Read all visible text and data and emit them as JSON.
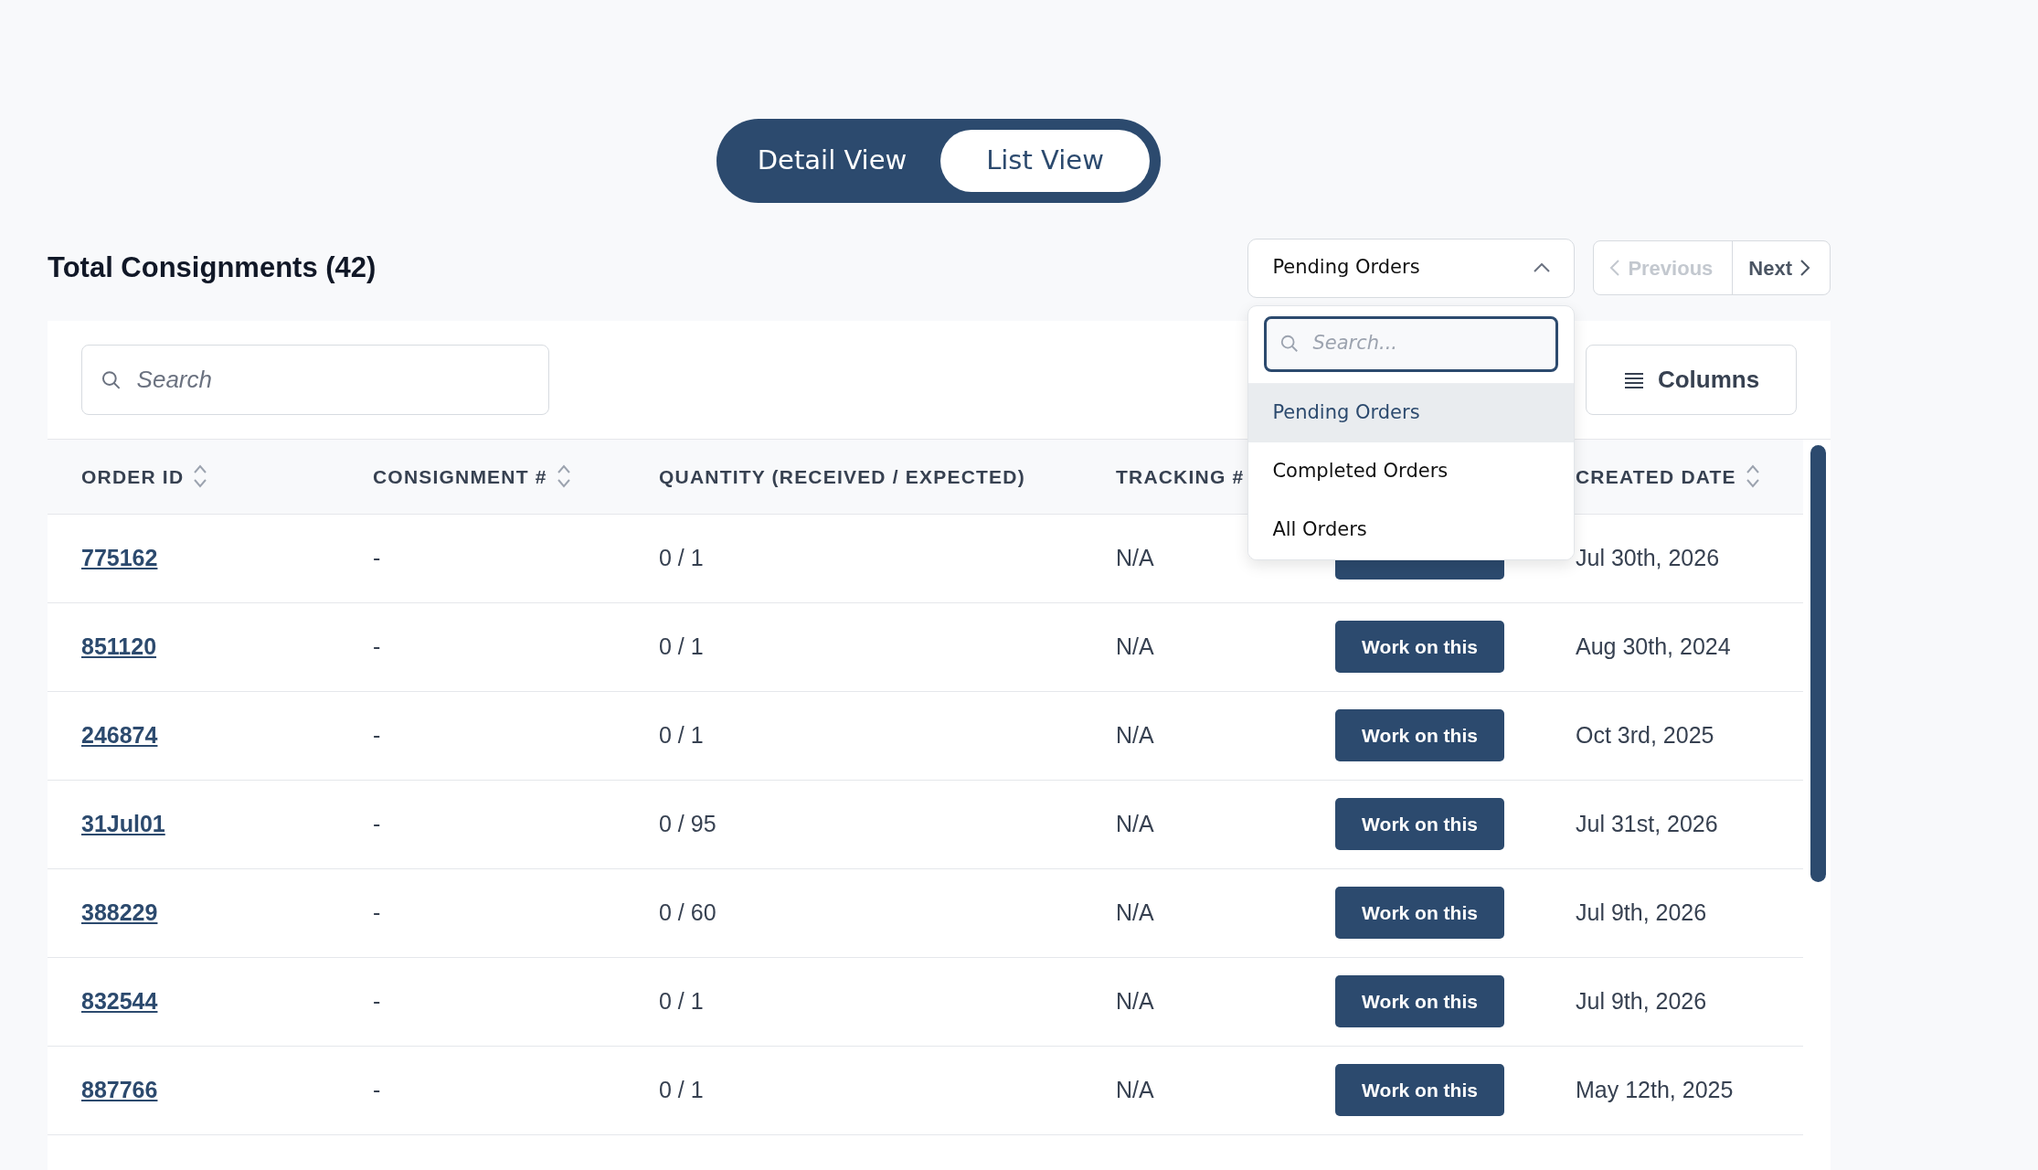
{
  "view_toggle": [
    {
      "label": "Detail View",
      "selected": false
    },
    {
      "label": "List View",
      "selected": true
    }
  ],
  "title": "Total Consignments (42)",
  "filter": {
    "value": "Pending Orders",
    "expanded": true,
    "search_placeholder": "Search...",
    "options": [
      {
        "label": "Pending Orders",
        "selected": true
      },
      {
        "label": "Completed Orders",
        "selected": false
      },
      {
        "label": "All Orders",
        "selected": false
      }
    ]
  },
  "pager": [
    {
      "label": "Previous",
      "kind": "prev",
      "disabled": true
    },
    {
      "label": "Next",
      "kind": "next",
      "disabled": false
    }
  ],
  "search": {
    "placeholder": "Search"
  },
  "columns_button": "Columns",
  "table": {
    "columns": [
      {
        "label": "ORDER ID",
        "sortable": true
      },
      {
        "label": "CONSIGNMENT #",
        "sortable": true
      },
      {
        "label": "QUANTITY (RECEIVED / EXPECTED)",
        "sortable": false
      },
      {
        "label": "TRACKING #",
        "sortable": false
      },
      {
        "label": "CREATED DATE",
        "sortable": true
      }
    ],
    "rows": [
      {
        "order_id": "775162",
        "consignment": "-",
        "quantity": "0 / 1",
        "tracking": "N/A",
        "created": "Jul 30th, 2026"
      },
      {
        "order_id": "851120",
        "consignment": "-",
        "quantity": "0 / 1",
        "tracking": "N/A",
        "action": "Work on this",
        "created": "Aug 30th, 2024"
      },
      {
        "order_id": "246874",
        "consignment": "-",
        "quantity": "0 / 1",
        "tracking": "N/A",
        "action": "Work on this",
        "created": "Oct 3rd, 2025"
      },
      {
        "order_id": "31Jul01",
        "consignment": "-",
        "quantity": "0 / 95",
        "tracking": "N/A",
        "action": "Work on this",
        "created": "Jul 31st, 2026"
      },
      {
        "order_id": "388229",
        "consignment": "-",
        "quantity": "0 / 60",
        "tracking": "N/A",
        "action": "Work on this",
        "created": "Jul 9th, 2026"
      },
      {
        "order_id": "832544",
        "consignment": "-",
        "quantity": "0 / 1",
        "tracking": "N/A",
        "action": "Work on this",
        "created": "Jul 9th, 2026"
      },
      {
        "order_id": "887766",
        "consignment": "-",
        "quantity": "0 / 1",
        "tracking": "N/A",
        "action": "Work on this",
        "created": "May 12th, 2025"
      }
    ]
  }
}
